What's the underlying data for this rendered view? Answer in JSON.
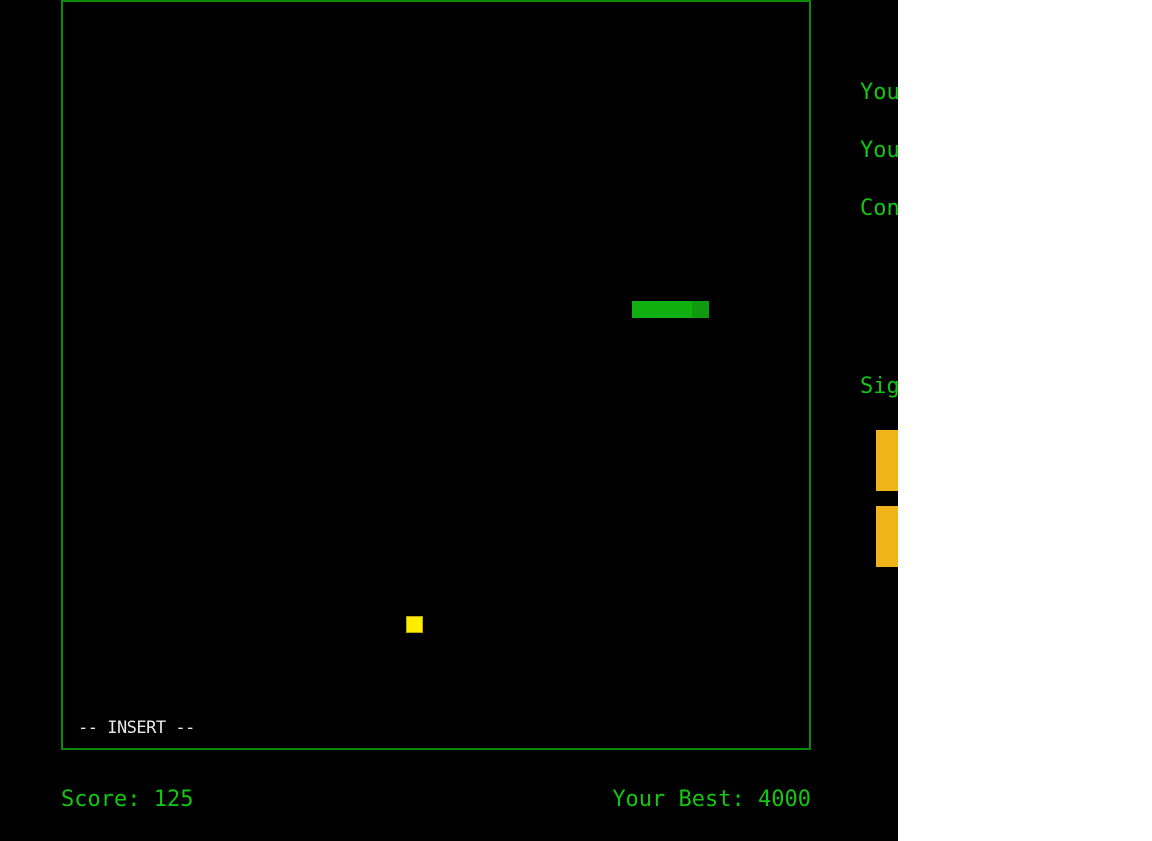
{
  "game": {
    "mode_indicator": "-- INSERT --",
    "score_text": "Score: 125",
    "best_text": "Your Best: 4000"
  },
  "side_panel": {
    "line1": "You",
    "line2": "You",
    "line3": "Con",
    "line4": "Sig"
  },
  "colors": {
    "background": "#000000",
    "border": "#0a8a0a",
    "text": "#13c613",
    "snake": "#10b010",
    "food": "#ffee00",
    "button": "#f0b41a"
  }
}
